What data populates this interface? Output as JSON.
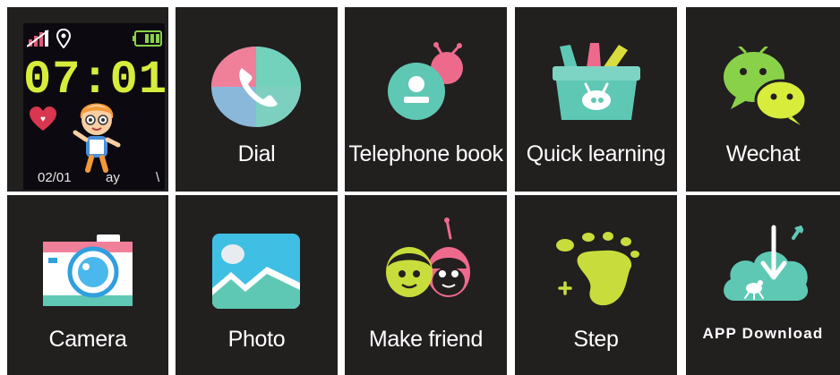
{
  "watch_face": {
    "time": "07:01",
    "date": "02/01",
    "day_partial": "ay",
    "day_partial_right": "\\",
    "icons": [
      "signal-icon",
      "location-pin-icon",
      "battery-icon",
      "heart-icon",
      "cartoon-kid-icon"
    ]
  },
  "apps": [
    {
      "label": "Dial",
      "icon": "phone-icon"
    },
    {
      "label": "Telephone book",
      "icon": "contacts-icon"
    },
    {
      "label": "Quick learning",
      "icon": "school-box-icon"
    },
    {
      "label": "Wechat",
      "icon": "wechat-icon"
    },
    {
      "label": "Camera",
      "icon": "camera-icon"
    },
    {
      "label": "Photo",
      "icon": "photo-icon"
    },
    {
      "label": "Make friend",
      "icon": "make-friend-icon"
    },
    {
      "label": "Step",
      "icon": "footprint-icon"
    },
    {
      "label": "APP Download",
      "icon": "cloud-download-icon"
    }
  ],
  "colors": {
    "tile_background": "#221f1f",
    "time_color": "#d8ec3c",
    "accent_pink": "#ee6a8c",
    "accent_teal": "#5fc8b4",
    "accent_yellow_green": "#c8dd3c"
  }
}
